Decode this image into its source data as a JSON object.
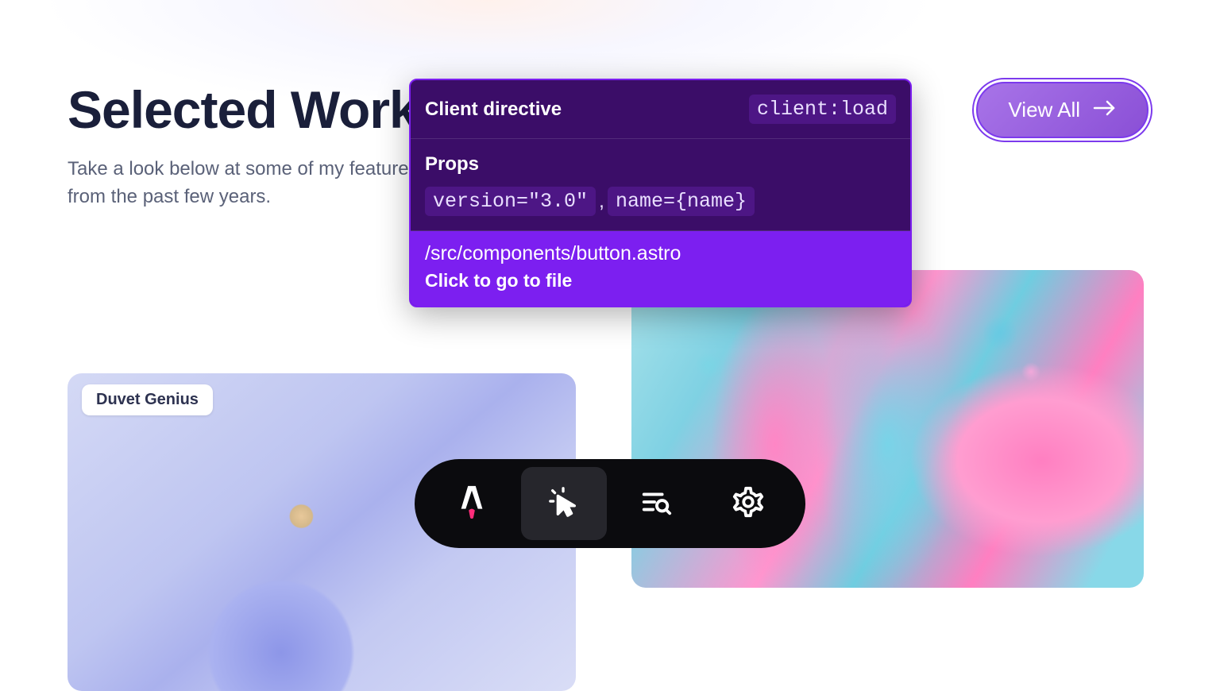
{
  "heading": "Selected Work",
  "subtitle": "Take a look below at some of my featured work for clients from the past few years.",
  "viewAll": {
    "label": "View All"
  },
  "tooltip": {
    "directive": {
      "label": "Client directive",
      "value": "client:load"
    },
    "props": {
      "label": "Props",
      "items": [
        "version=\"3.0\"",
        "name={name}"
      ]
    },
    "filePath": "/src/components/button.astro",
    "clickHint": "Click to go to file"
  },
  "cards": [
    {
      "badge": "Duvet Genius"
    }
  ],
  "toolbar": {
    "items": [
      {
        "icon": "astro"
      },
      {
        "icon": "cursor",
        "active": true
      },
      {
        "icon": "list-search"
      },
      {
        "icon": "settings"
      }
    ]
  }
}
